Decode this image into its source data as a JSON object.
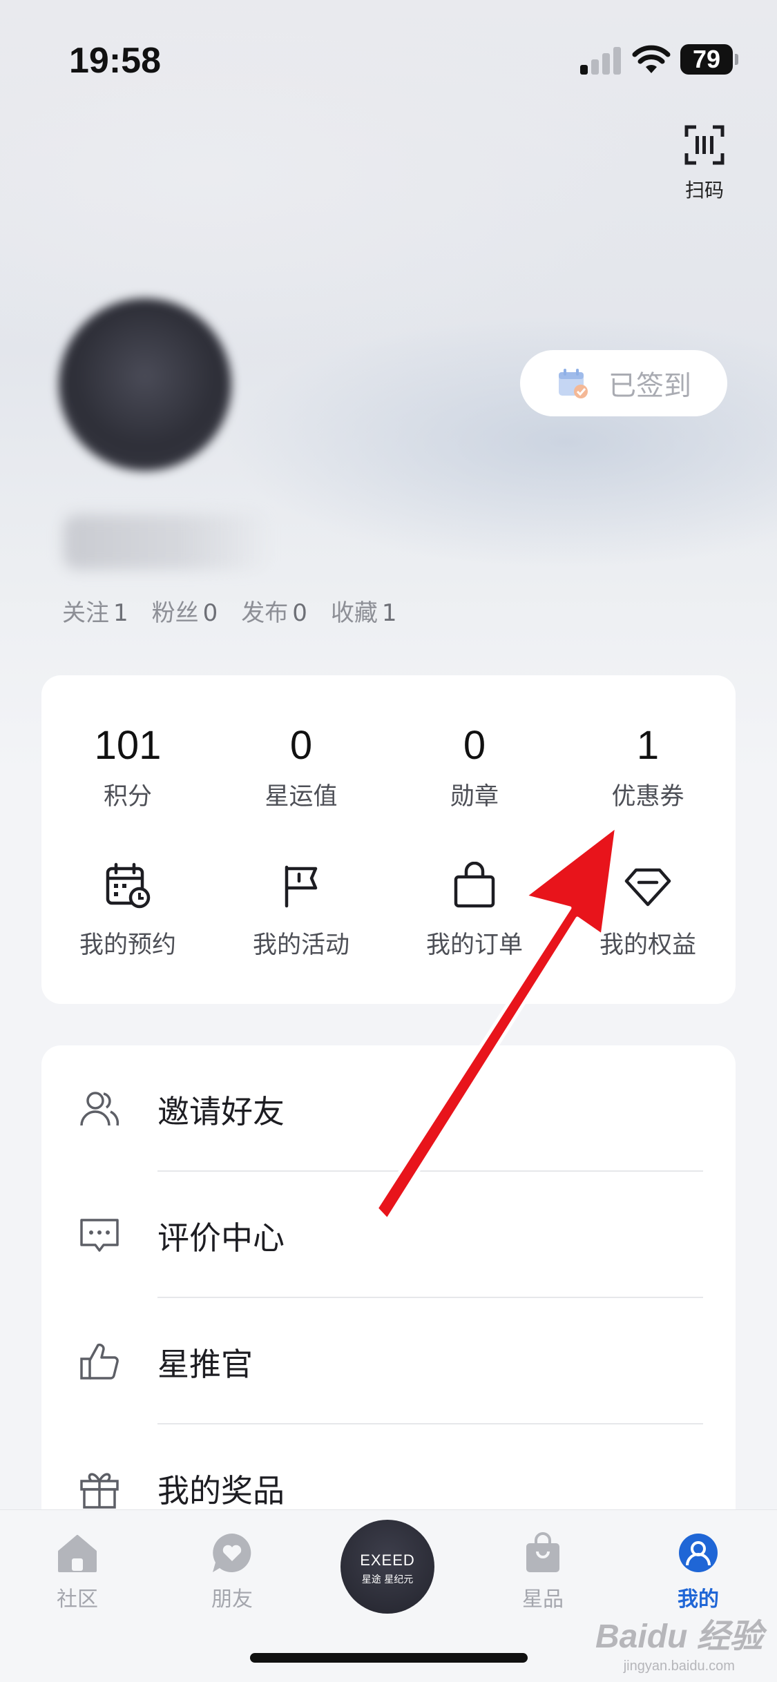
{
  "status_bar": {
    "time": "19:58",
    "battery": "79"
  },
  "header": {
    "scan_label": "扫码"
  },
  "profile": {
    "signin_label": "已签到",
    "stats": [
      {
        "label": "关注",
        "value": "1"
      },
      {
        "label": "粉丝",
        "value": "0"
      },
      {
        "label": "发布",
        "value": "0"
      },
      {
        "label": "收藏",
        "value": "1"
      }
    ]
  },
  "metrics": [
    {
      "value": "101",
      "label": "积分"
    },
    {
      "value": "0",
      "label": "星运值"
    },
    {
      "value": "0",
      "label": "勋章"
    },
    {
      "value": "1",
      "label": "优惠券"
    }
  ],
  "shortcuts": [
    {
      "label": "我的预约",
      "icon": "calendar-clock-icon"
    },
    {
      "label": "我的活动",
      "icon": "flag-icon"
    },
    {
      "label": "我的订单",
      "icon": "shopping-bag-icon"
    },
    {
      "label": "我的权益",
      "icon": "diamond-icon"
    }
  ],
  "menu": [
    {
      "label": "邀请好友",
      "icon": "users-icon"
    },
    {
      "label": "评价中心",
      "icon": "comment-icon"
    },
    {
      "label": "星推官",
      "icon": "thumbs-up-icon"
    },
    {
      "label": "我的奖品",
      "icon": "gift-icon"
    }
  ],
  "tabbar": {
    "tabs": [
      {
        "label": "社区",
        "icon": "home-icon",
        "active": false
      },
      {
        "label": "朋友",
        "icon": "chat-heart-icon",
        "active": false
      },
      {
        "label": "星品",
        "icon": "bag-icon",
        "active": false
      },
      {
        "label": "我的",
        "icon": "person-icon",
        "active": true
      }
    ],
    "center_brand": "EXEED",
    "center_sub": "星途 星纪元"
  },
  "watermark": {
    "main": "Baidu 经验",
    "sub": "jingyan.baidu.com"
  },
  "colors": {
    "accent": "#1f66d6",
    "arrow": "#e8141b",
    "muted_text": "#8d8f96"
  }
}
